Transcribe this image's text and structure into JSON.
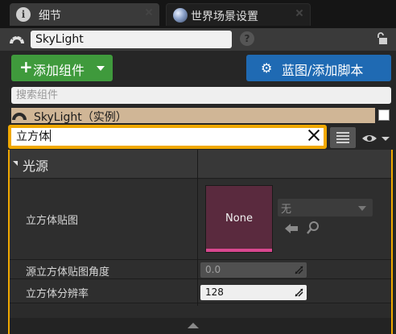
{
  "tabs": [
    {
      "label": "细节",
      "icon": "info-icon"
    },
    {
      "label": "世界场景设置",
      "icon": "world-sphere-icon"
    }
  ],
  "actor": {
    "name": "SkyLight",
    "icon": "skylight-icon"
  },
  "toolbar": {
    "add_component_label": "添加组件",
    "blueprint_label": "蓝图/添加脚本"
  },
  "component_search": {
    "placeholder": "搜索组件"
  },
  "component_tree": {
    "root_label": "SkyLight（实例）"
  },
  "property_filter": {
    "value": "立方体"
  },
  "details": {
    "category": "光源",
    "properties": [
      {
        "label": "立方体贴图",
        "thumbnail_text": "None",
        "asset_value": "无"
      },
      {
        "label": "源立方体贴图角度",
        "value": "0.0"
      },
      {
        "label": "立方体分辨率",
        "value": "128"
      }
    ]
  },
  "colors": {
    "add_button": "#3f9a3c",
    "blueprint_button": "#1f6ab3",
    "highlight": "#f0a800",
    "component_row": "#d0b696",
    "cubemap_accent": "#d9478f"
  }
}
